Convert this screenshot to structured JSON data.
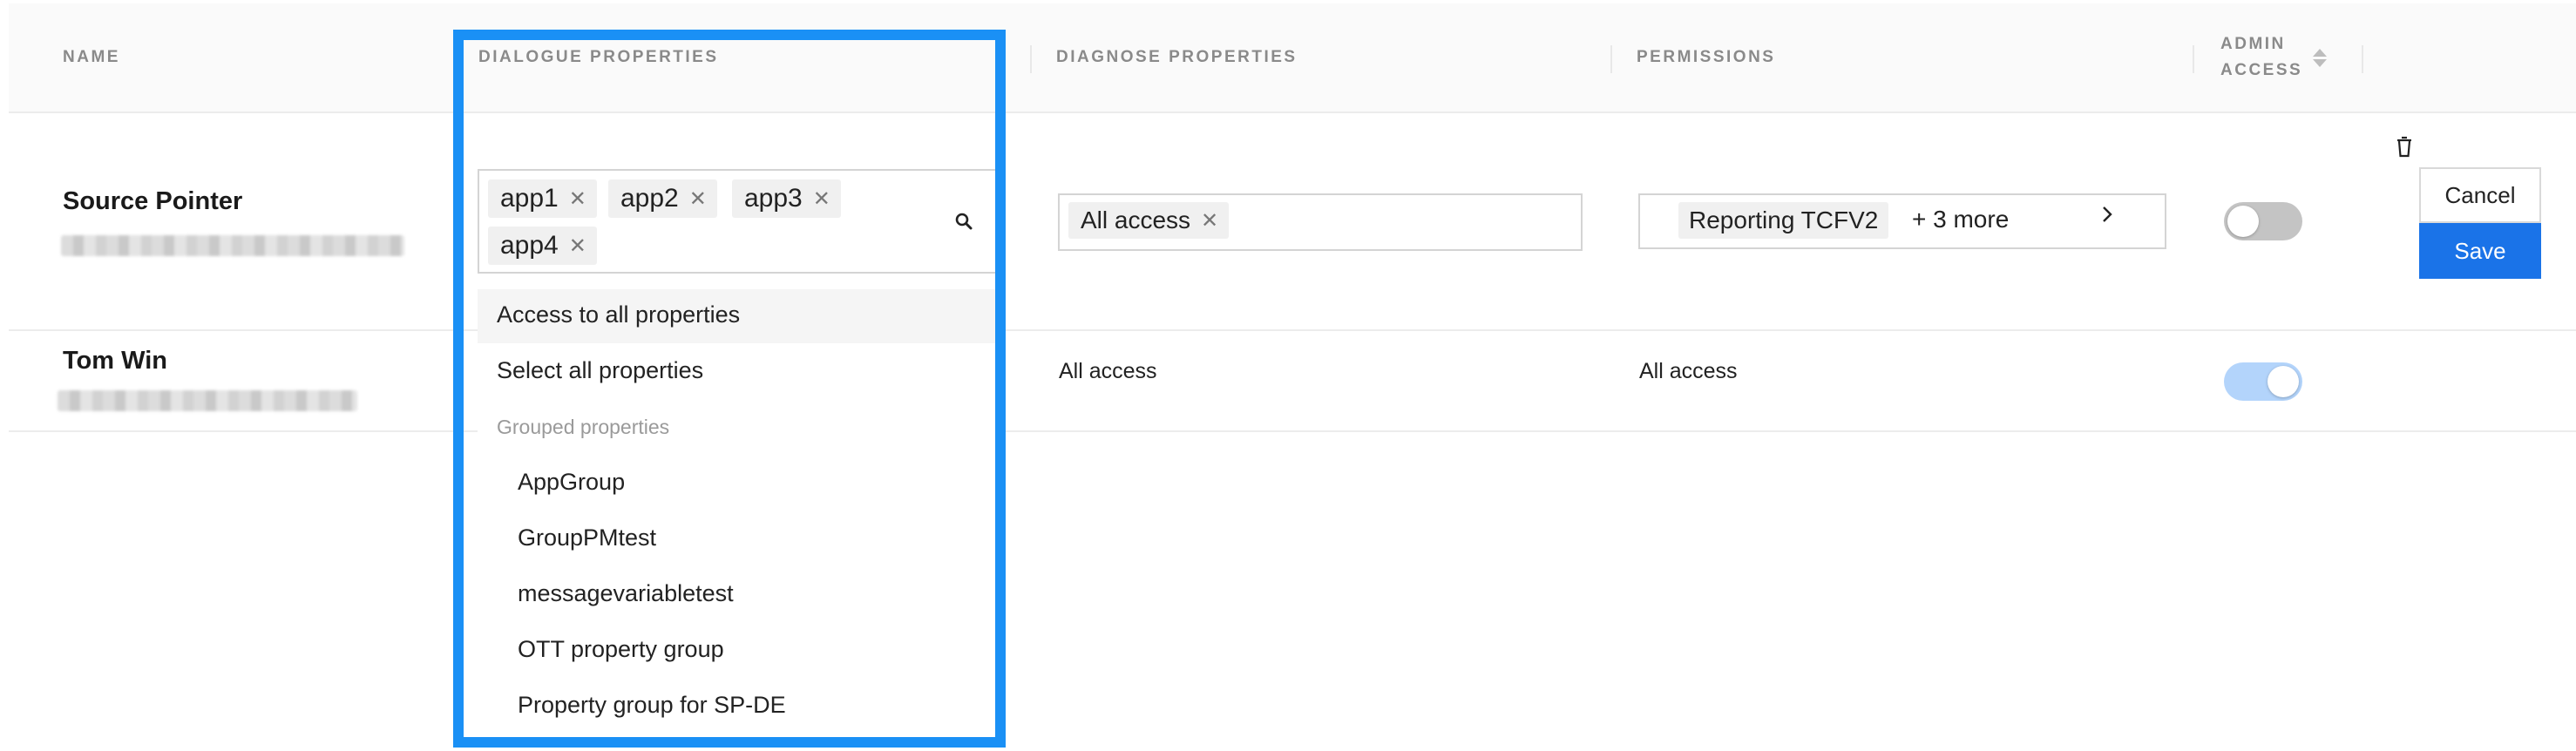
{
  "columns": {
    "name": "NAME",
    "dialogue": "DIALOGUE PROPERTIES",
    "diagnose": "DIAGNOSE PROPERTIES",
    "permissions": "PERMISSIONS",
    "admin_access_line1": "ADMIN",
    "admin_access_line2": "ACCESS"
  },
  "rows": [
    {
      "name": "Source Pointer",
      "dialogue_tags": [
        "app1",
        "app2",
        "app3",
        "app4"
      ],
      "diagnose_tags": [
        "All access"
      ],
      "permissions_tag": "Reporting TCFV2",
      "permissions_more": "+ 3 more",
      "admin_access": false,
      "cancel_label": "Cancel",
      "save_label": "Save"
    },
    {
      "name": "Tom Win",
      "diagnose": "All access",
      "permissions": "All access",
      "admin_access": true
    }
  ],
  "dropdown": {
    "options": [
      "Access to all properties",
      "Select all properties"
    ],
    "group_label": "Grouped properties",
    "groups": [
      "AppGroup",
      "GroupPMtest",
      "messagevariabletest",
      "OTT property group",
      "Property group for SP-DE"
    ]
  },
  "icons": {
    "tag_remove": "close-icon",
    "search": "search-icon",
    "expand": "chevron-right-icon",
    "delete": "trash-icon",
    "sort": "sort-icon"
  },
  "colors": {
    "accent": "#1a73e8",
    "highlight": "#1a90f5",
    "toggle_on": "#b3d4fb",
    "toggle_off": "#c4c4c4"
  }
}
